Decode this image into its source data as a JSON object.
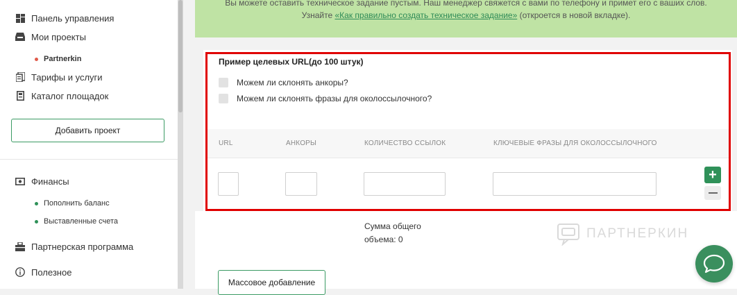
{
  "sidebar": {
    "items": [
      {
        "label": "Панель управления",
        "icon": "dashboard-icon"
      },
      {
        "label": "Мои проекты",
        "icon": "inbox-icon"
      },
      {
        "label": "Тарифы и услуги",
        "icon": "tariffs-icon"
      },
      {
        "label": "Каталог площадок",
        "icon": "catalog-icon"
      }
    ],
    "project": {
      "label": "Partnerkin",
      "dot_color": "#e05a4a"
    },
    "add_project_label": "Добавить проект",
    "finance": {
      "label": "Финансы",
      "icon": "money-icon"
    },
    "finance_subitems": [
      {
        "label": "Пополнить баланс",
        "dot_color": "#2f9159"
      },
      {
        "label": "Выставленные счета",
        "dot_color": "#2f9159"
      }
    ],
    "partner_program": {
      "label": "Партнерская программа",
      "icon": "partner-icon"
    },
    "useful": {
      "label": "Полезное",
      "icon": "info-icon"
    }
  },
  "banner": {
    "line1": "Вы можете оставить техническое задание пустым. Наш менеджер свяжется с вами по телефону и примет его с ваших слов.",
    "line2_prefix": "Узнайте ",
    "link": "«Как правильно создать техническое задание»",
    "line2_suffix": " (откроется в новой вкладке)."
  },
  "form": {
    "title": "Пример целевых URL(до 100 штук)",
    "checkbox1": "Можем ли склонять анкоры?",
    "checkbox2": "Можем ли склонять фразы для околоссылочного?",
    "columns": [
      "URL",
      "АНКОРЫ",
      "КОЛИЧЕСТВО ССЫЛОК",
      "КЛЮЧЕВЫЕ ФРАЗЫ ДЛЯ ОКОЛОССЫЛОЧНОГО"
    ],
    "plus_label": "+"
  },
  "summary": {
    "line1": "Сумма общего",
    "line2": "объема: 0"
  },
  "watermark": "ПАРТНЕРКИН",
  "mass_add_label": "Массовое добавление",
  "colors": {
    "accent": "#2f9159",
    "banner_bg": "#bfe3a4",
    "highlight": "#e00000"
  }
}
